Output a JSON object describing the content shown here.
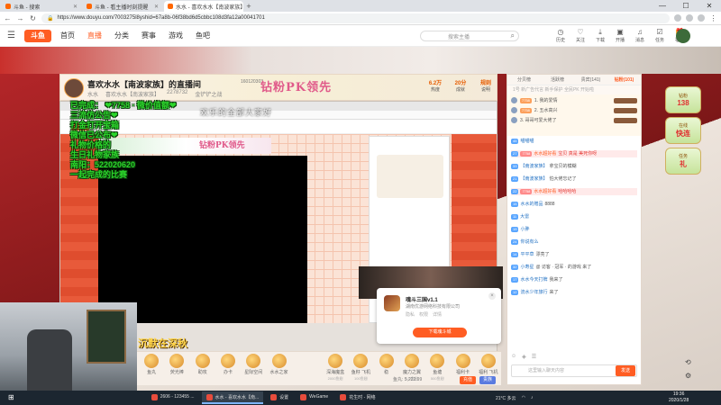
{
  "browser": {
    "tabs": [
      {
        "title": "斗鱼 - 搜索",
        "active": false
      },
      {
        "title": "斗鱼 - 看主播时刻提醒",
        "active": false
      },
      {
        "title": "水水 - 喜欢水水【南波家族】直播",
        "active": true
      }
    ],
    "url": "https://www.douyu.com/7003275l8yshid=67a8b-06f38bd6d5cbbc108d3fa12a00041701",
    "window_controls": [
      "—",
      "☐",
      "✕"
    ]
  },
  "douyu_header": {
    "logo": "斗鱼",
    "nav": [
      "首页",
      "直播",
      "分类",
      "赛事",
      "游戏",
      "鱼吧"
    ],
    "search_placeholder": "搜索主播",
    "icons": [
      "历史",
      "关注",
      "下载",
      "开播",
      "消息",
      "任务",
      "福利"
    ]
  },
  "room": {
    "title": "喜欢水水【南波家族】的直播间",
    "room_id": "160120303",
    "sub": [
      "水水",
      "喜欢水水【南波家族】",
      "2278732",
      "金铲铲之战"
    ],
    "pk_banner": "钻粉PK领先",
    "stats": [
      {
        "value": "6.2万",
        "label": "热度"
      },
      {
        "value": "20分",
        "label": "成就"
      },
      {
        "value": "规则",
        "label": "说明"
      }
    ]
  },
  "overlay": {
    "chat_lines": [
      "已完成：  ❤7758 · 微价值额❤",
      "  三流仿公告❤",
      "  打金打开宝箱",
      "  微信已公布❤",
      "  礼物价格的",
      "  生日礼物家族",
      "  南阳：522020620",
      "  一起完成的比赛"
    ],
    "watermark": "欢乐的全部大家好",
    "gold_text": "沉默在深秋"
  },
  "popup": {
    "title": "魂斗三国v1.1",
    "org": "湖南优游网络科技有限公司",
    "tags": [
      "隐私",
      "权限",
      "详情"
    ],
    "button": "下载魂斗城",
    "close": "×"
  },
  "gifts": [
    {
      "name": "鱼丸",
      "price": ""
    },
    {
      "name": "荧光棒",
      "price": ""
    },
    {
      "name": "助攻",
      "price": ""
    },
    {
      "name": "办卡",
      "price": ""
    },
    {
      "name": "星际空间",
      "price": ""
    },
    {
      "name": "水水之家",
      "price": ""
    },
    {
      "name": "深海魔盒",
      "price": "2000鱼翅"
    },
    {
      "name": "鱼籽 飞机",
      "price": "100鱼翅"
    },
    {
      "name": "稳",
      "price": ""
    },
    {
      "name": "魔力之翼",
      "price": "1.0鱼翅"
    },
    {
      "name": "鱼塘",
      "price": "500鱼翅"
    },
    {
      "name": "福利卡",
      "price": ""
    },
    {
      "name": "福利 飞机",
      "price": ""
    }
  ],
  "balance": "鱼丸: 5,222.99",
  "recharge": "充值",
  "vip": "贵族",
  "chat": {
    "tabs": [
      "分贝榜",
      "活跃榜",
      "贵宾(141)",
      "钻粉(101)"
    ],
    "promo": "1号 新广告代言 新手保护 全民PK 开始啦",
    "rank": [
      {
        "name": "1. 我的爱情",
        "badge": "7758"
      },
      {
        "name": "2. 五水高兴",
        "badge": "7758"
      },
      {
        "name": "3. 哥哥可爱大佬了",
        "badge": ""
      }
    ],
    "messages": [
      {
        "lv": "45",
        "fan": "",
        "user": "喵喵喵",
        "text": "",
        "red": false
      },
      {
        "lv": "27",
        "fan": "7758",
        "user": "水水超好看",
        "text": "宝贝 真是 美死你呀",
        "red": true
      },
      {
        "lv": "33",
        "fan": "",
        "user": "【南波家族】",
        "text": "拿宝贝的模糊",
        "red": false
      },
      {
        "lv": "21",
        "fan": "",
        "user": "【南波家族】",
        "text": "怕大佬忘记了",
        "red": false
      },
      {
        "lv": "22",
        "fan": "7758",
        "user": "水水超好看",
        "text": "哈哈哈哈",
        "red": true
      },
      {
        "lv": "15",
        "fan": "",
        "user": "水水的赠品",
        "text": "8888",
        "red": false
      },
      {
        "lv": "11",
        "fan": "",
        "user": "大雷",
        "text": "",
        "red": false
      },
      {
        "lv": "19",
        "fan": "",
        "user": "小胖",
        "text": "",
        "red": false
      },
      {
        "lv": "24",
        "fan": "",
        "user": "你说有么",
        "text": "",
        "red": false
      },
      {
        "lv": "14",
        "fan": "",
        "user": "平平草",
        "text": "漂亮了",
        "red": false
      },
      {
        "lv": "32",
        "fan": "",
        "user": "小寿星",
        "text": "@ 访客 · 冠军 · 的游戏 来了",
        "red": false
      },
      {
        "lv": "17",
        "fan": "",
        "user": "水水今天打牌",
        "text": "我来了",
        "red": false
      },
      {
        "lv": "12",
        "fan": "",
        "user": "流水少年旅行",
        "text": "来了",
        "red": false
      }
    ],
    "input_placeholder": "这里输入聊天内容",
    "send": "发送"
  },
  "sidebar": [
    {
      "title": "钻粉",
      "value": "138"
    },
    {
      "title": "在线",
      "value": "快连"
    },
    {
      "title": "任务",
      "value": "礼"
    }
  ],
  "taskbar": {
    "items": [
      {
        "label": "2606 - 123455 ...",
        "active": false
      },
      {
        "label": "水水 - 喜欢水水【南...",
        "active": true
      },
      {
        "label": "设置",
        "active": false
      },
      {
        "label": "WeGame",
        "active": false
      },
      {
        "label": "花生时 - 网络",
        "active": false
      }
    ],
    "tray": "21°C 多云",
    "time": "19:36",
    "date": "2020/1/28"
  }
}
